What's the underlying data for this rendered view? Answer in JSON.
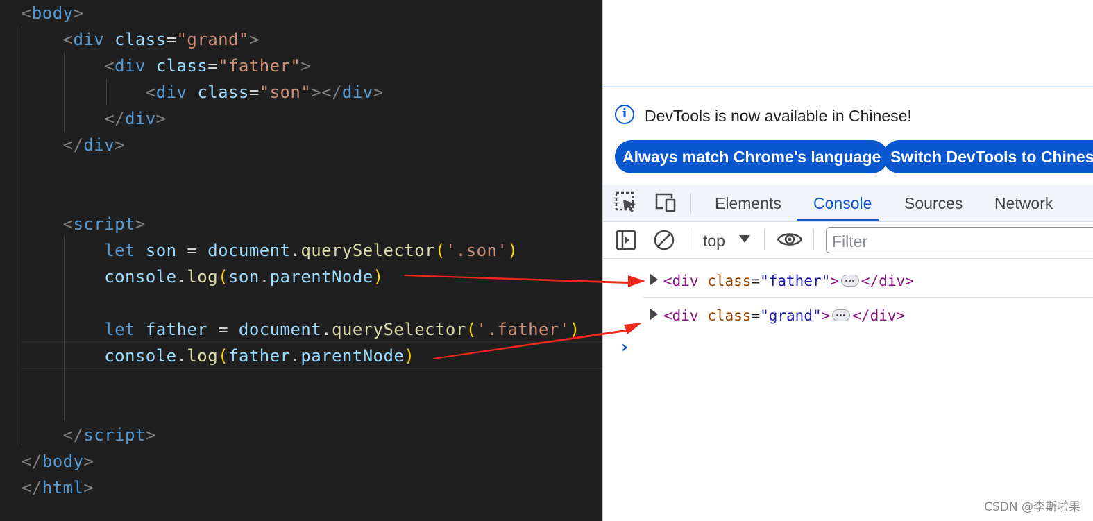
{
  "editor": {
    "lines": [
      [
        {
          "t": "<",
          "c": "t-punc"
        },
        {
          "t": "body",
          "c": "t-tag"
        },
        {
          "t": ">",
          "c": "t-punc"
        }
      ],
      [
        {
          "t": "    <",
          "c": "t-punc"
        },
        {
          "t": "div",
          "c": "t-tag"
        },
        {
          "t": " "
        },
        {
          "t": "class",
          "c": "t-attr"
        },
        {
          "t": "=",
          "c": "t-eq"
        },
        {
          "t": "\"grand\"",
          "c": "t-str"
        },
        {
          "t": ">",
          "c": "t-punc"
        }
      ],
      [
        {
          "t": "        <",
          "c": "t-punc"
        },
        {
          "t": "div",
          "c": "t-tag"
        },
        {
          "t": " "
        },
        {
          "t": "class",
          "c": "t-attr"
        },
        {
          "t": "=",
          "c": "t-eq"
        },
        {
          "t": "\"father\"",
          "c": "t-str"
        },
        {
          "t": ">",
          "c": "t-punc"
        }
      ],
      [
        {
          "t": "            <",
          "c": "t-punc"
        },
        {
          "t": "div",
          "c": "t-tag"
        },
        {
          "t": " "
        },
        {
          "t": "class",
          "c": "t-attr"
        },
        {
          "t": "=",
          "c": "t-eq"
        },
        {
          "t": "\"son\"",
          "c": "t-str"
        },
        {
          "t": "></",
          "c": "t-punc"
        },
        {
          "t": "div",
          "c": "t-tag"
        },
        {
          "t": ">",
          "c": "t-punc"
        }
      ],
      [
        {
          "t": "        </",
          "c": "t-punc"
        },
        {
          "t": "div",
          "c": "t-tag"
        },
        {
          "t": ">",
          "c": "t-punc"
        }
      ],
      [
        {
          "t": "    </",
          "c": "t-punc"
        },
        {
          "t": "div",
          "c": "t-tag"
        },
        {
          "t": ">",
          "c": "t-punc"
        }
      ],
      [],
      [],
      [
        {
          "t": "    <",
          "c": "t-punc"
        },
        {
          "t": "script",
          "c": "t-tag"
        },
        {
          "t": ">",
          "c": "t-punc"
        }
      ],
      [
        {
          "t": "        "
        },
        {
          "t": "let",
          "c": "t-kw"
        },
        {
          "t": " "
        },
        {
          "t": "son",
          "c": "t-var"
        },
        {
          "t": " = ",
          "c": "t-op"
        },
        {
          "t": "document",
          "c": "t-var"
        },
        {
          "t": ".",
          "c": "t-op"
        },
        {
          "t": "querySelector",
          "c": "t-fn"
        },
        {
          "t": "(",
          "c": "t-par"
        },
        {
          "t": "'.son'",
          "c": "t-str"
        },
        {
          "t": ")",
          "c": "t-par"
        }
      ],
      [
        {
          "t": "        "
        },
        {
          "t": "console",
          "c": "t-var"
        },
        {
          "t": ".",
          "c": "t-op"
        },
        {
          "t": "log",
          "c": "t-fn"
        },
        {
          "t": "(",
          "c": "t-par"
        },
        {
          "t": "son",
          "c": "t-var"
        },
        {
          "t": ".",
          "c": "t-op"
        },
        {
          "t": "parentNode",
          "c": "t-var"
        },
        {
          "t": ")",
          "c": "t-par"
        }
      ],
      [],
      [
        {
          "t": "        "
        },
        {
          "t": "let",
          "c": "t-kw"
        },
        {
          "t": " "
        },
        {
          "t": "father",
          "c": "t-var"
        },
        {
          "t": " = ",
          "c": "t-op"
        },
        {
          "t": "document",
          "c": "t-var"
        },
        {
          "t": ".",
          "c": "t-op"
        },
        {
          "t": "querySelector",
          "c": "t-fn"
        },
        {
          "t": "(",
          "c": "t-par"
        },
        {
          "t": "'.father'",
          "c": "t-str"
        },
        {
          "t": ")",
          "c": "t-par"
        }
      ],
      [
        {
          "t": "        "
        },
        {
          "t": "console",
          "c": "t-var"
        },
        {
          "t": ".",
          "c": "t-op"
        },
        {
          "t": "log",
          "c": "t-fn"
        },
        {
          "t": "(",
          "c": "t-par"
        },
        {
          "t": "father",
          "c": "t-var"
        },
        {
          "t": ".",
          "c": "t-op"
        },
        {
          "t": "parentNode",
          "c": "t-var"
        },
        {
          "t": ")",
          "c": "t-par"
        }
      ],
      [],
      [],
      [
        {
          "t": "    </",
          "c": "t-punc"
        },
        {
          "t": "script",
          "c": "t-tag"
        },
        {
          "t": ">",
          "c": "t-punc"
        }
      ],
      [
        {
          "t": "</",
          "c": "t-punc"
        },
        {
          "t": "body",
          "c": "t-tag"
        },
        {
          "t": ">",
          "c": "t-punc"
        }
      ],
      [
        {
          "t": "</",
          "c": "t-punc"
        },
        {
          "t": "html",
          "c": "t-tag"
        },
        {
          "t": ">",
          "c": "t-punc"
        }
      ]
    ]
  },
  "devtools": {
    "info": {
      "icon": "info-icon",
      "icon_glyph": "i",
      "message": "DevTools is now available in Chinese!",
      "button_match": "Always match Chrome's language",
      "button_switch": "Switch DevTools to Chinese"
    },
    "tabs": {
      "inspect_icon": "inspect-element-icon",
      "device_icon": "device-toolbar-icon",
      "elements": "Elements",
      "console": "Console",
      "sources": "Sources",
      "network": "Network",
      "active": "Console"
    },
    "toolbar": {
      "sidebar_icon": "sidebar-toggle-icon",
      "clear_icon": "clear-console-icon",
      "context": "top",
      "eye_icon": "live-expression-eye-icon",
      "filter_placeholder": "Filter"
    },
    "console": {
      "entries": [
        {
          "open": "<div",
          "attr": "class",
          "value": "\"father\"",
          "close": "</div>"
        },
        {
          "open": "<div",
          "attr": "class",
          "value": "\"grand\"",
          "close": "</div>"
        }
      ],
      "prompt": "›"
    }
  },
  "annotation": {
    "arrow_color": "#f0271c"
  },
  "watermark": "CSDN @李斯啦果",
  "colors": {
    "editor_bg": "#1f1f1f",
    "accent": "#0b57d0"
  }
}
